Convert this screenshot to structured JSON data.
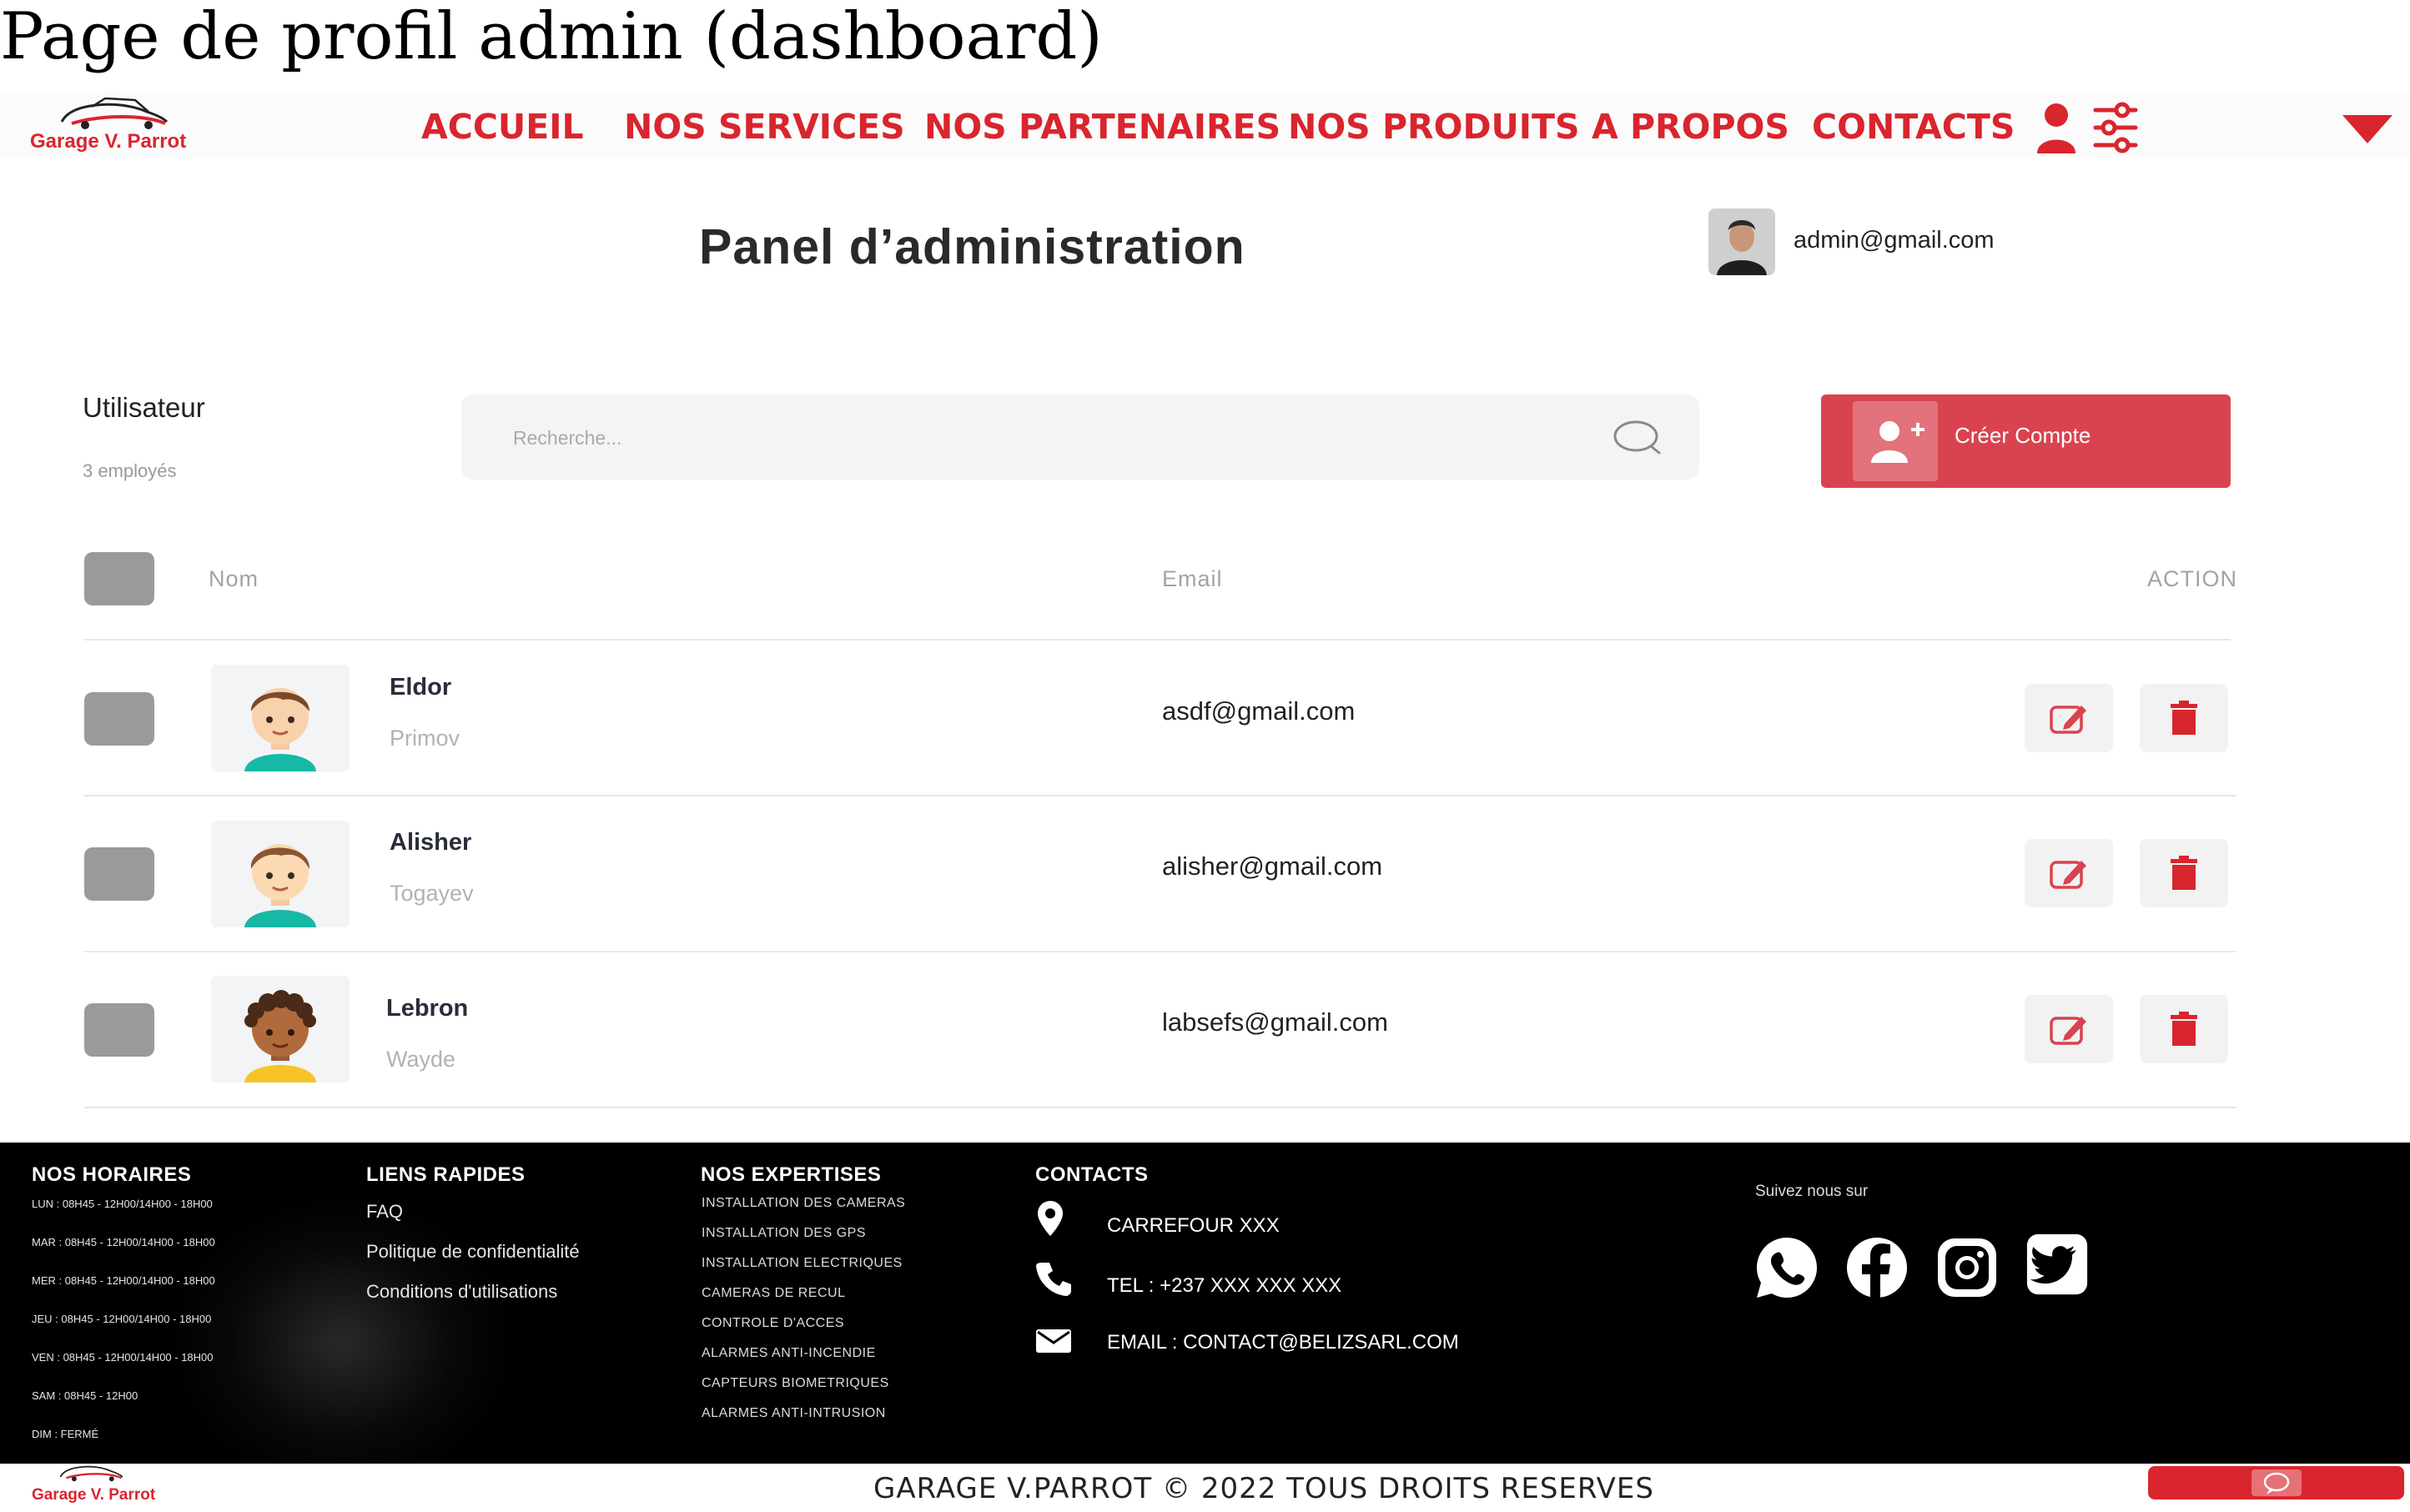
{
  "caption": "Page de profil admin (dashboard)",
  "brand": {
    "name": "Garage V. Parrot",
    "accent": "#d9252e"
  },
  "nav": {
    "items": [
      "ACCUEIL",
      "NOS SERVICES",
      "NOS PARTENAIRES",
      "NOS PRODUITS",
      "A PROPOS",
      "CONTACTS"
    ],
    "icons": [
      "user-icon",
      "sliders-icon",
      "caret-down-icon"
    ]
  },
  "panel": {
    "title": "Panel  d’administration",
    "admin_email": "admin@gmail.com"
  },
  "users_section": {
    "title": "Utilisateur",
    "count": "3 employés",
    "search_placeholder": "Recherche...",
    "create_button": "Créer Compte"
  },
  "table": {
    "headers": {
      "name": "Nom",
      "email": "Email",
      "action": "ACTION"
    },
    "rows": [
      {
        "first": "Eldor",
        "last": "Primov",
        "email": "asdf@gmail.com",
        "avatar": "boy-avatar"
      },
      {
        "first": "Alisher",
        "last": "Togayev",
        "email": "alisher@gmail.com",
        "avatar": "boy-avatar"
      },
      {
        "first": "Lebron",
        "last": "Wayde",
        "email": "labsefs@gmail.com",
        "avatar": "curly-boy-avatar"
      }
    ]
  },
  "footer": {
    "hours": {
      "title": "NOS HORAIRES",
      "lines": [
        "LUN  : 08H45 - 12H00/14H00 - 18H00",
        "MAR : 08H45 - 12H00/14H00 - 18H00",
        "MER : 08H45 - 12H00/14H00 - 18H00",
        "JEU  : 08H45 - 12H00/14H00 - 18H00",
        "VEN  : 08H45 - 12H00/14H00 - 18H00",
        "SAM : 08H45 - 12H00",
        "DIM  : FERMÉ"
      ]
    },
    "links": {
      "title": "LIENS RAPIDES",
      "items": [
        "FAQ",
        "Politique de confidentialité",
        "Conditions d'utilisations"
      ]
    },
    "expertises": {
      "title": "NOS EXPERTISES",
      "items": [
        "INSTALLATION DES CAMERAS",
        "INSTALLATION DES GPS",
        "INSTALLATION ELECTRIQUES",
        "CAMERAS DE RECUL",
        "CONTROLE D'ACCES",
        "ALARMES ANTI-INCENDIE",
        "CAPTEURS BIOMETRIQUES",
        "ALARMES ANTI-INTRUSION"
      ]
    },
    "contacts": {
      "title": "CONTACTS",
      "address": "CARREFOUR XXX",
      "phone": "TEL : +237 XXX XXX XXX",
      "email": "EMAIL : CONTACT@BELIZSARL.COM"
    },
    "social": {
      "label": "Suivez nous sur",
      "icons": [
        "whatsapp-icon",
        "facebook-icon",
        "instagram-icon",
        "twitter-icon"
      ]
    },
    "copyright": "GARAGE V.PARROT © 2022 TOUS DROITS RESERVES"
  }
}
